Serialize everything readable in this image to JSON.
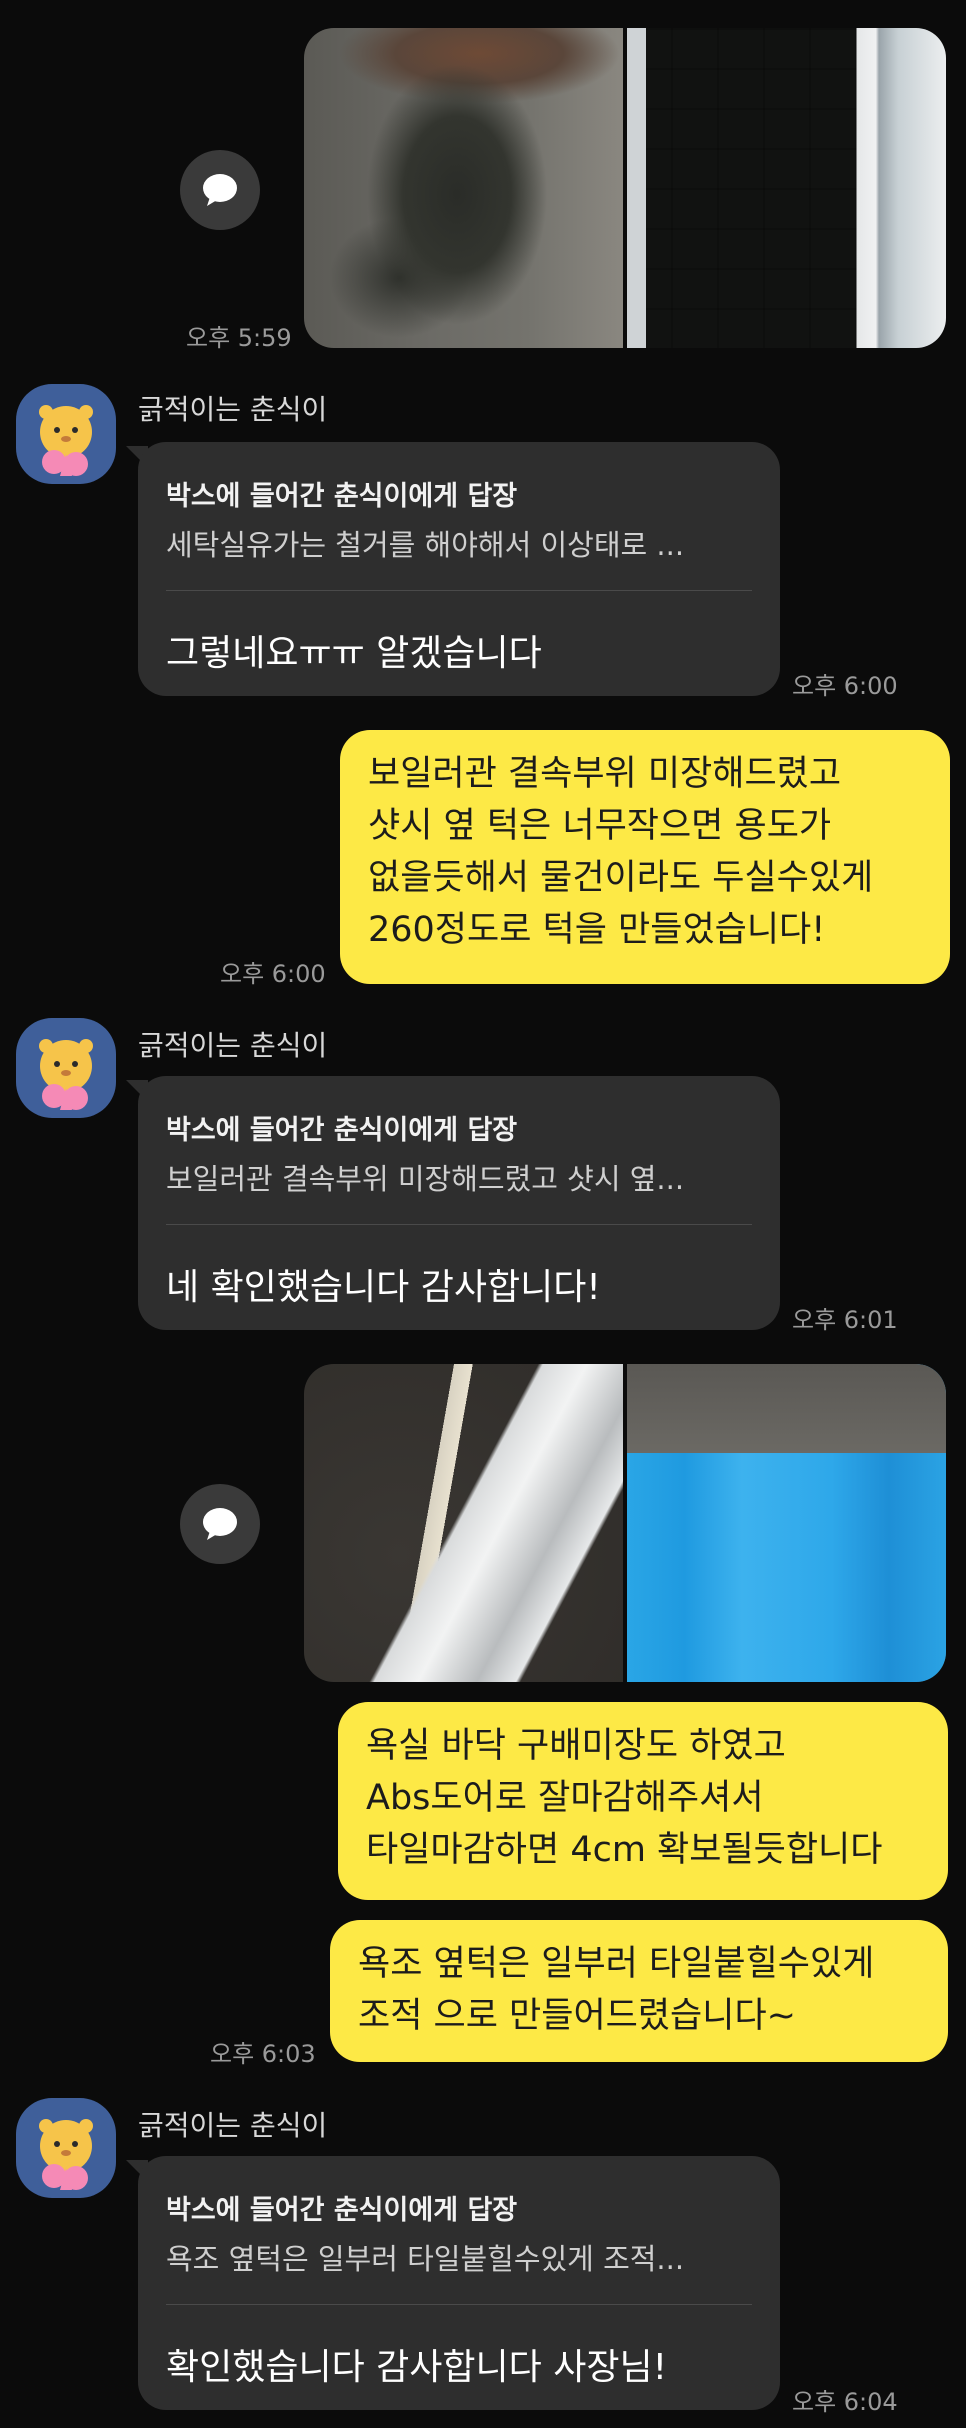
{
  "contact": {
    "name": "긁적이는 춘식이"
  },
  "messages": [
    {
      "id": "m1",
      "type": "photos",
      "side": "right",
      "time": "오후 5:59",
      "photos": [
        "water-damaged-floor-photo",
        "balcony-tile-floor-photo"
      ]
    },
    {
      "id": "m2",
      "type": "reply",
      "side": "left",
      "sender": "긁적이는 춘식이",
      "reply_title": "박스에 들어간 춘식이에게 답장",
      "quoted": "세탁실유가는 철거를 해야해서 이상태로 ...",
      "text": "그렇네요ㅠㅠ 알겠습니다",
      "time": "오후 6:00"
    },
    {
      "id": "m3",
      "type": "text",
      "side": "right",
      "lines": [
        "보일러관 결속부위 미장해드렸고",
        "샷시 옆 턱은 너무작으면 용도가",
        "없을듯해서 물건이라도 두실수있게",
        "260정도로 턱을 만들었습니다!"
      ],
      "time": "오후 6:00"
    },
    {
      "id": "m4",
      "type": "reply",
      "side": "left",
      "sender": "긁적이는 춘식이",
      "reply_title": "박스에 들어간 춘식이에게 답장",
      "quoted": "보일러관 결속부위 미장해드렸고 샷시 옆...",
      "text": "네 확인했습니다 감사합니다!",
      "time": "오후 6:01"
    },
    {
      "id": "m5",
      "type": "photos",
      "side": "right",
      "photos": [
        "measuring-tape-threshold-photo",
        "blue-waterproofed-bathroom-photo"
      ]
    },
    {
      "id": "m6",
      "type": "text",
      "side": "right",
      "lines": [
        "욕실 바닥 구배미장도 하였고",
        "Abs도어로 잘마감해주셔서",
        "타일마감하면 4cm 확보될듯합니다"
      ]
    },
    {
      "id": "m7",
      "type": "text",
      "side": "right",
      "lines": [
        "욕조 옆턱은 일부러 타일붙힐수있게",
        "조적 으로 만들어드렸습니다~"
      ],
      "time": "오후 6:03"
    },
    {
      "id": "m8",
      "type": "reply",
      "side": "left",
      "sender": "긁적이는 춘식이",
      "reply_title": "박스에 들어간 춘식이에게 답장",
      "quoted": "욕조 옆턱은 일부러 타일붙힐수있게 조적...",
      "text": "확인했습니다 감사합니다 사장님!",
      "time": "오후 6:04"
    }
  ],
  "colors": {
    "background": "#0b0b0b",
    "my_bubble": "#fde946",
    "their_bubble": "#2e2e2e",
    "time_text": "#9a9a9a"
  }
}
